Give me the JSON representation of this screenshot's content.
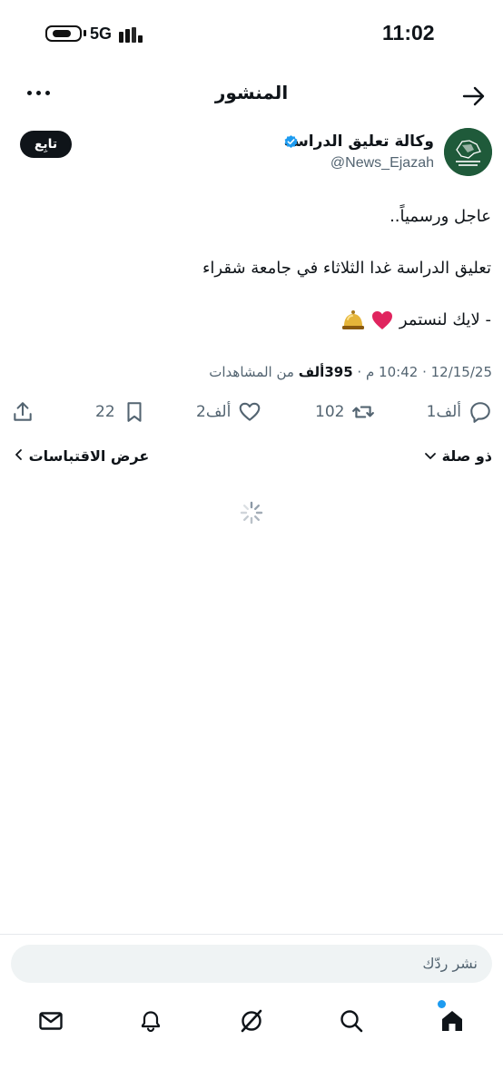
{
  "status_bar": {
    "time": "11:02",
    "network": "5G",
    "battery_level": 0.75
  },
  "header": {
    "title": "المنشور",
    "icons": [
      "back-arrow-icon",
      "more-options-icon"
    ]
  },
  "author": {
    "display_name": "وكالة تعليق الدراسة",
    "handle": "@News_Ejazah",
    "verified": true,
    "follow_label": "تابِع",
    "avatar_colors": {
      "bg": "#1f5a3a",
      "mark": "#ffffff"
    }
  },
  "post": {
    "line1": "عاجل ورسمياً..",
    "line2": "تعليق الدراسة غدا الثلاثاء في جامعة شقراء",
    "line3": "- لايك لنستمر",
    "emojis": [
      "heart-emoji",
      "bell-emoji"
    ]
  },
  "meta": {
    "date": "12/15/25",
    "separator": "·",
    "time": "10:42 م",
    "views_count": "395ألف",
    "views_label": "من المشاهدات"
  },
  "actions": {
    "replies": "1ألف",
    "reposts": "102",
    "likes": "2ألف",
    "bookmarks": "22"
  },
  "thread": {
    "relevance_label": "ذو صلة",
    "quotes_label": "عرض الاقتباسات"
  },
  "reply": {
    "placeholder": "نشر ردّك"
  },
  "nav": {
    "items": [
      "home-icon",
      "search-icon",
      "grok-icon",
      "notifications-icon",
      "messages-icon"
    ],
    "active": "home-icon",
    "accent": "#1d9bf0"
  },
  "colors": {
    "text": "#0f1419",
    "muted": "#536471",
    "verified": "#1d9bf0",
    "heart": "#e0245e"
  }
}
